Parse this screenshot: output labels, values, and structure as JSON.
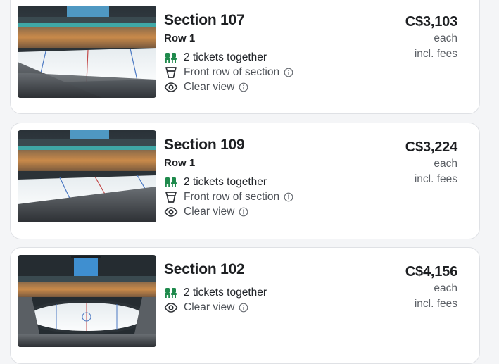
{
  "listings": [
    {
      "section": "Section 107",
      "row": "Row 1",
      "features": [
        {
          "icon": "seats-icon",
          "text": "2 tickets together",
          "info": false
        },
        {
          "icon": "cup-icon",
          "text": "Front row of section",
          "info": true
        },
        {
          "icon": "eye-icon",
          "text": "Clear view",
          "info": true
        }
      ],
      "price": "C$3,103",
      "price_unit": "each",
      "price_note": "incl. fees"
    },
    {
      "section": "Section 109",
      "row": "Row 1",
      "features": [
        {
          "icon": "seats-icon",
          "text": "2 tickets together",
          "info": false
        },
        {
          "icon": "cup-icon",
          "text": "Front row of section",
          "info": true
        },
        {
          "icon": "eye-icon",
          "text": "Clear view",
          "info": true
        }
      ],
      "price": "C$3,224",
      "price_unit": "each",
      "price_note": "incl. fees"
    },
    {
      "section": "Section 102",
      "features": [
        {
          "icon": "seats-icon",
          "text": "2 tickets together",
          "info": false
        },
        {
          "icon": "eye-icon",
          "text": "Clear view",
          "info": true
        }
      ],
      "price": "C$4,156",
      "price_unit": "each",
      "price_note": "incl. fees"
    }
  ],
  "colors": {
    "accent_green": "#1f8a4c",
    "text_primary": "#1d1f22",
    "text_muted": "#5c6066",
    "card_border": "#dfe1e5"
  }
}
